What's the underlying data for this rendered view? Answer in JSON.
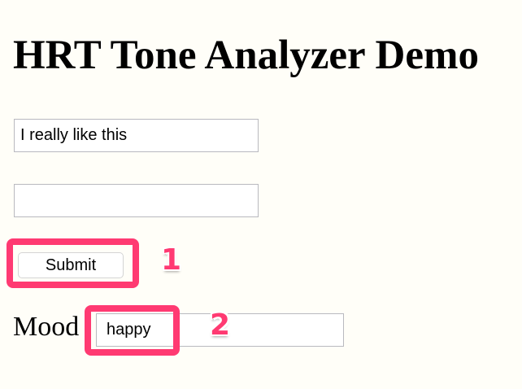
{
  "page": {
    "title": "HRT Tone Analyzer Demo"
  },
  "form": {
    "input_1_value": "I really like this",
    "input_2_value": "",
    "submit_label": "Submit",
    "mood_label": "Mood",
    "mood_value": "happy"
  },
  "annotations": {
    "items": [
      {
        "number": "1"
      },
      {
        "number": "2"
      }
    ],
    "color": "#ff3a72"
  },
  "colors": {
    "background": "#fffef8",
    "highlight": "#ff3a72"
  }
}
